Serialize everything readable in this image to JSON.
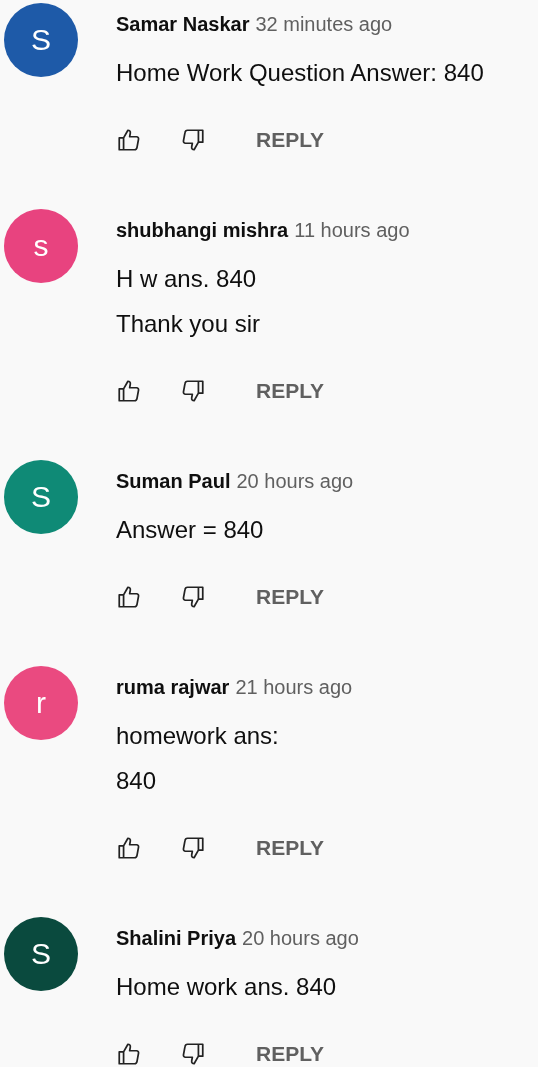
{
  "comments": [
    {
      "initial": "S",
      "color": "#1e5aa8",
      "author": "Samar Naskar",
      "time": "32 minutes ago",
      "text": "Home Work Question Answer: 840",
      "reply": "REPLY"
    },
    {
      "initial": "s",
      "color": "#e8437f",
      "author": "shubhangi mishra",
      "time": "11 hours ago",
      "text": "H w ans. 840\nThank you sir",
      "reply": "REPLY"
    },
    {
      "initial": "S",
      "color": "#0f8a76",
      "author": "Suman Paul",
      "time": "20 hours ago",
      "text": "Answer = 840",
      "reply": "REPLY"
    },
    {
      "initial": "r",
      "color": "#ea4a80",
      "author": "ruma rajwar",
      "time": "21 hours ago",
      "text": "homework ans:\n840",
      "reply": "REPLY"
    },
    {
      "initial": "S",
      "color": "#0a4a3e",
      "author": "Shalini Priya",
      "time": "20 hours ago",
      "text": "Home work ans. 840",
      "reply": "REPLY"
    }
  ]
}
